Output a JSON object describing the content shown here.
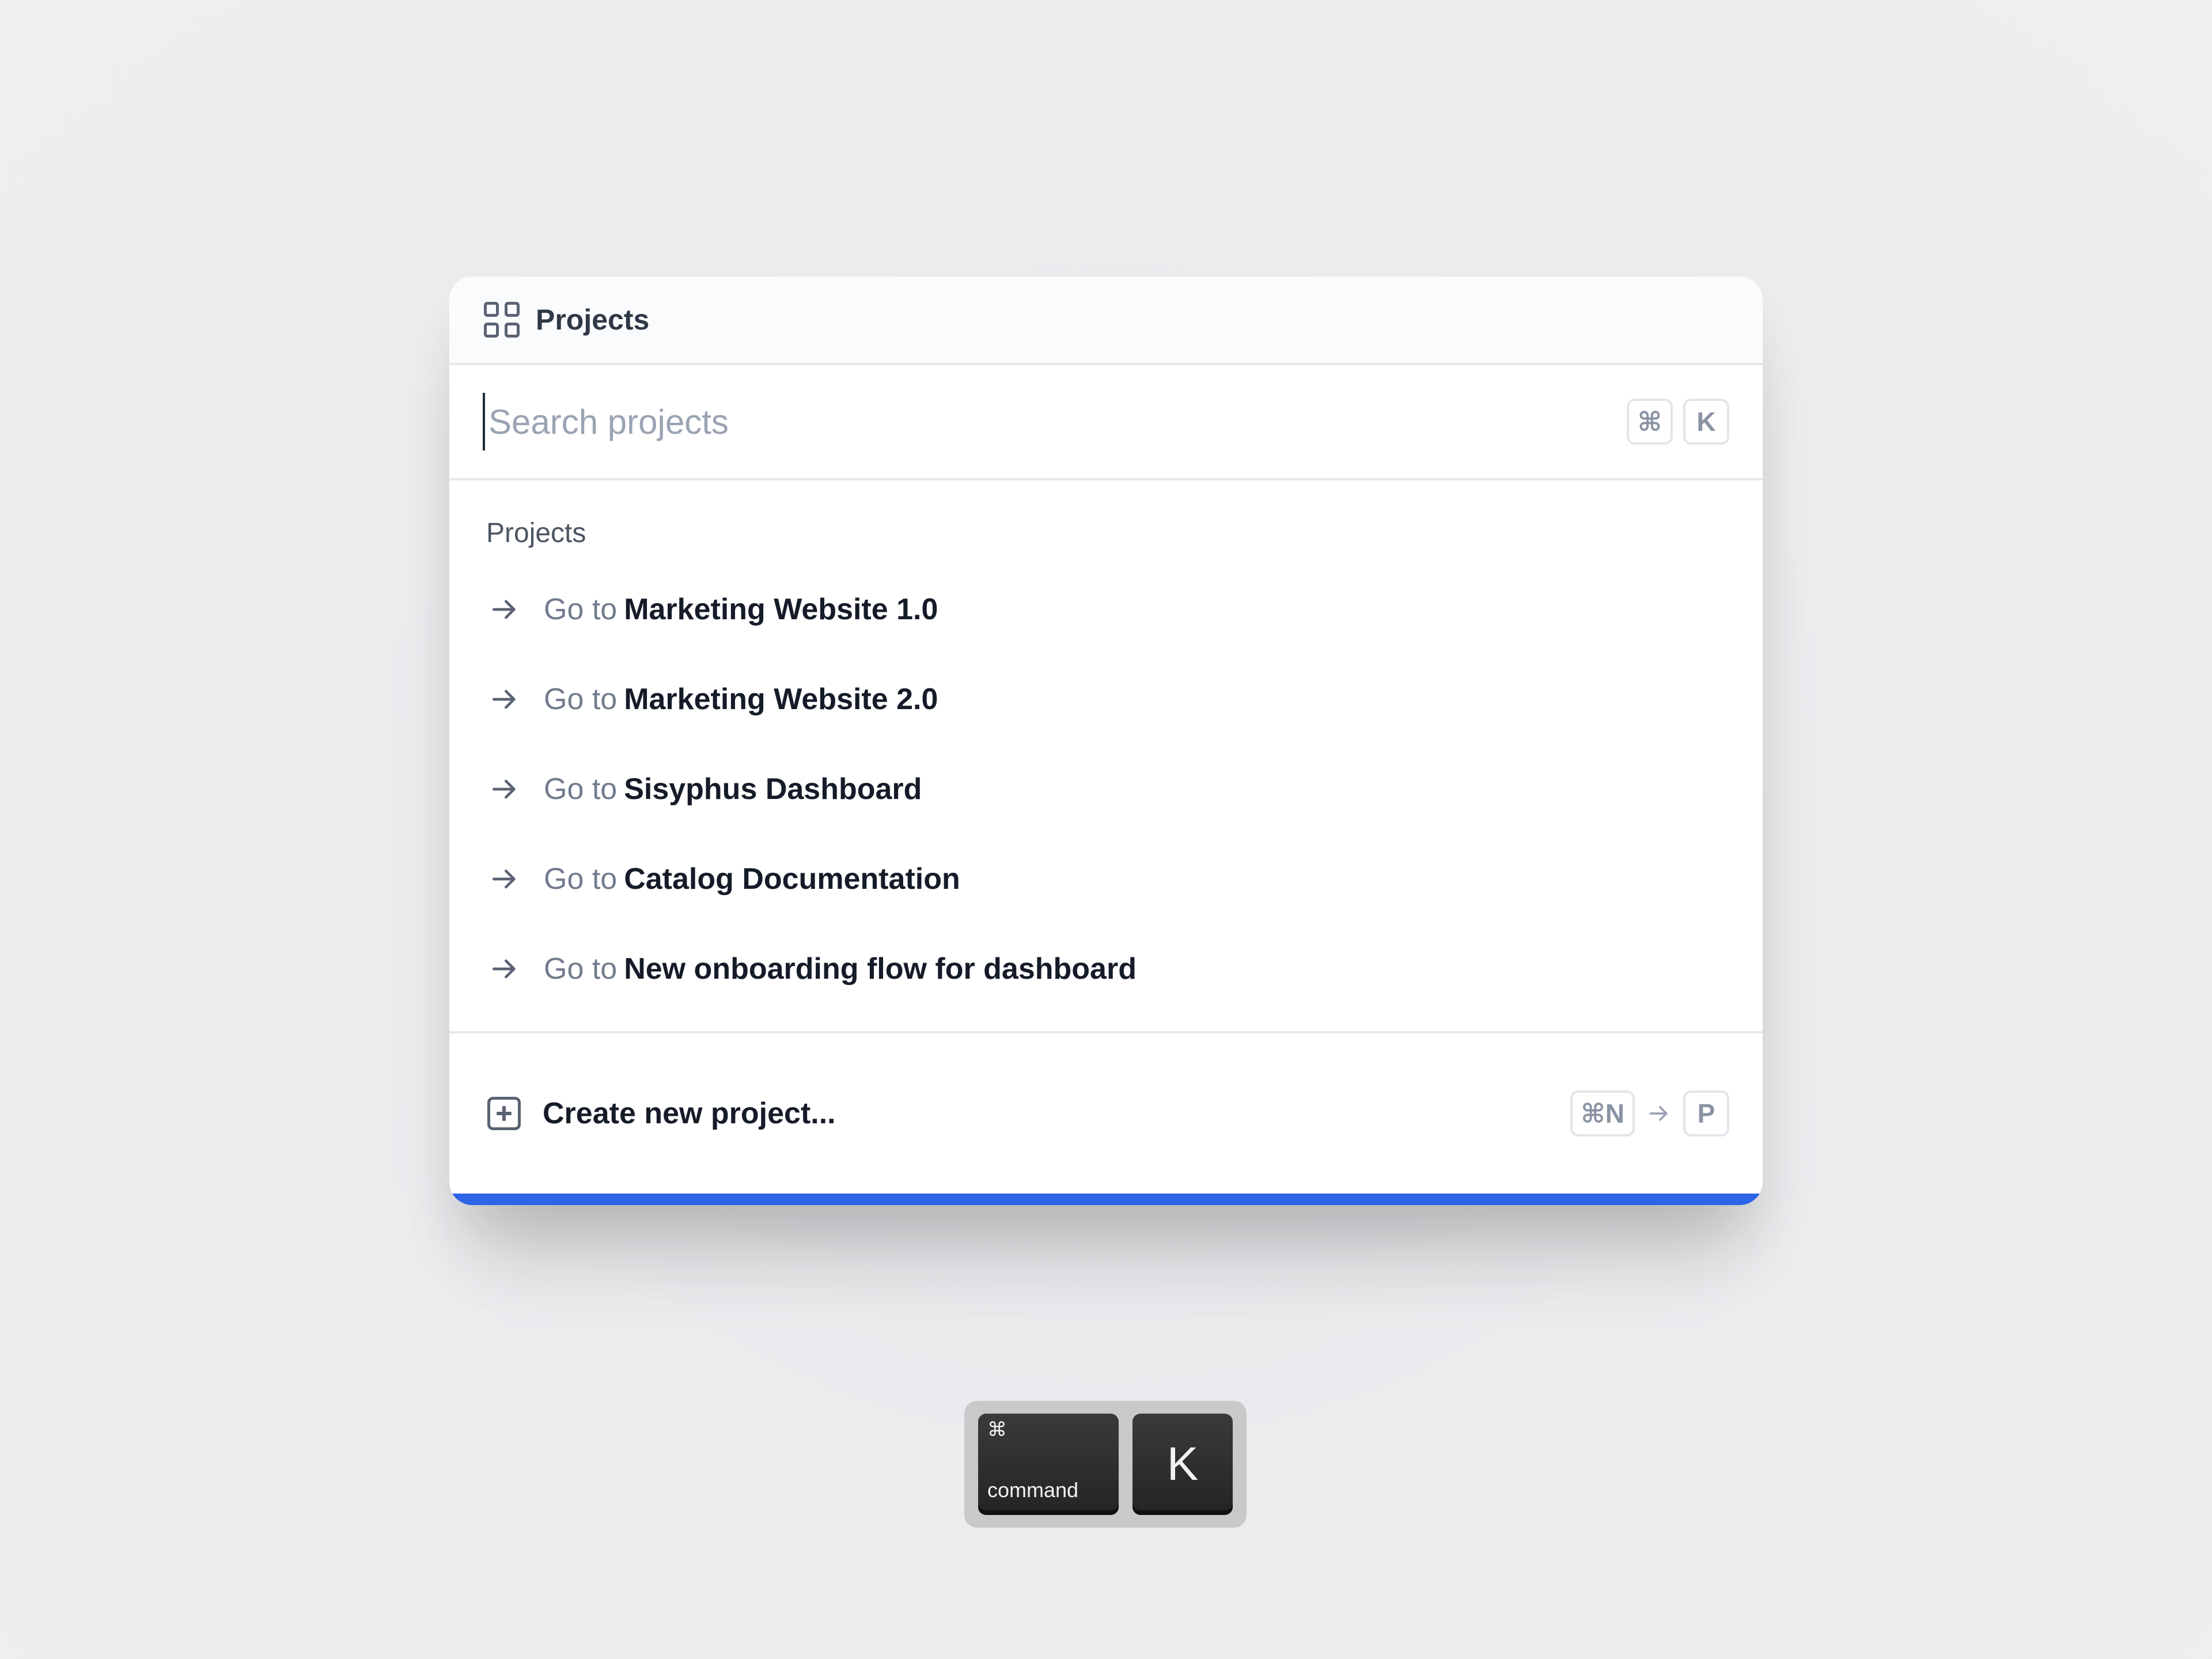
{
  "header": {
    "title": "Projects",
    "icon": "grid-icon"
  },
  "search": {
    "placeholder": "Search projects",
    "value": "",
    "shortcut_keys": [
      "⌘",
      "K"
    ]
  },
  "list": {
    "section_label": "Projects",
    "prefix": "Go to",
    "items": [
      {
        "name": "Marketing Website 1.0"
      },
      {
        "name": "Marketing Website 2.0"
      },
      {
        "name": "Sisyphus Dashboard"
      },
      {
        "name": "Catalog Documentation"
      },
      {
        "name": "New onboarding flow for dashboard"
      }
    ]
  },
  "footer": {
    "create_label": "Create new project...",
    "shortcut_first": "⌘N",
    "shortcut_second": "P"
  },
  "keyboard": {
    "command_symbol": "⌘",
    "command_label": "command",
    "k_label": "K"
  },
  "colors": {
    "accent": "#2d64e8",
    "background": "#ecedef",
    "text_primary": "#151b28",
    "text_muted": "#717b8c"
  }
}
